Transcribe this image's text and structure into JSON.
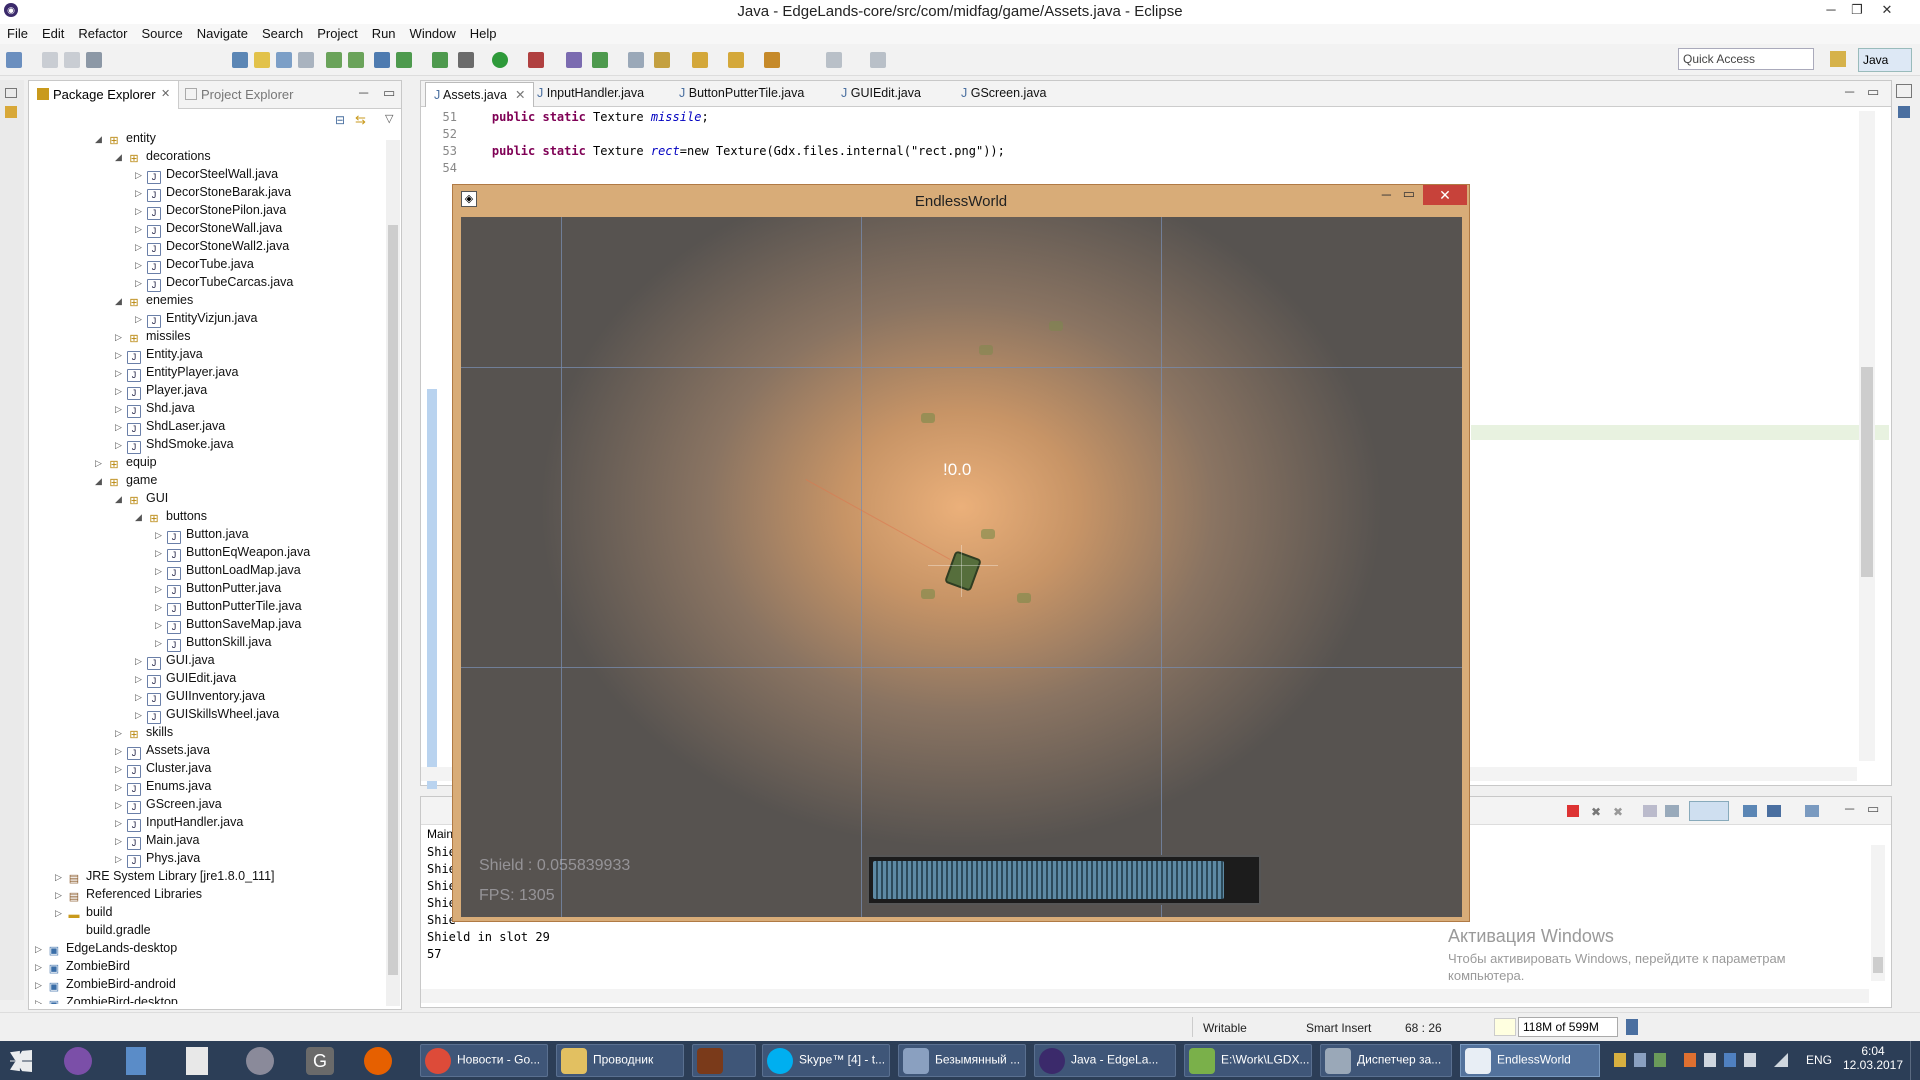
{
  "window": {
    "title": "Java - EdgeLands-core/src/com/midfag/game/Assets.java - Eclipse",
    "minimize": "─",
    "maximize": "❐",
    "close": "✕"
  },
  "menu": [
    "File",
    "Edit",
    "Refactor",
    "Source",
    "Navigate",
    "Search",
    "Project",
    "Run",
    "Window",
    "Help"
  ],
  "toolbar": {
    "quick_access": "Quick Access",
    "perspective": "Java"
  },
  "package_explorer": {
    "tab_active": "Package Explorer",
    "tab_other": "Project Explorer",
    "rows": [
      {
        "label": "entity",
        "kind": "pkg",
        "indent": 4,
        "open": true
      },
      {
        "label": "decorations",
        "kind": "pkg",
        "indent": 5,
        "open": true
      },
      {
        "label": "DecorSteelWall.java",
        "kind": "java",
        "indent": 6
      },
      {
        "label": "DecorStoneBarak.java",
        "kind": "java",
        "indent": 6
      },
      {
        "label": "DecorStonePilon.java",
        "kind": "java",
        "indent": 6
      },
      {
        "label": "DecorStoneWall.java",
        "kind": "java",
        "indent": 6
      },
      {
        "label": "DecorStoneWall2.java",
        "kind": "java",
        "indent": 6
      },
      {
        "label": "DecorTube.java",
        "kind": "java",
        "indent": 6
      },
      {
        "label": "DecorTubeCarcas.java",
        "kind": "java",
        "indent": 6
      },
      {
        "label": "enemies",
        "kind": "pkg",
        "indent": 5,
        "open": true
      },
      {
        "label": "EntityVizjun.java",
        "kind": "java",
        "indent": 6
      },
      {
        "label": "missiles",
        "kind": "pkg",
        "indent": 5
      },
      {
        "label": "Entity.java",
        "kind": "java",
        "indent": 5
      },
      {
        "label": "EntityPlayer.java",
        "kind": "java",
        "indent": 5
      },
      {
        "label": "Player.java",
        "kind": "java",
        "indent": 5
      },
      {
        "label": "Shd.java",
        "kind": "java",
        "indent": 5
      },
      {
        "label": "ShdLaser.java",
        "kind": "java",
        "indent": 5
      },
      {
        "label": "ShdSmoke.java",
        "kind": "java",
        "indent": 5
      },
      {
        "label": "equip",
        "kind": "pkg",
        "indent": 4
      },
      {
        "label": "game",
        "kind": "pkg",
        "indent": 4,
        "open": true
      },
      {
        "label": "GUI",
        "kind": "pkg",
        "indent": 5,
        "open": true
      },
      {
        "label": "buttons",
        "kind": "pkg",
        "indent": 6,
        "open": true
      },
      {
        "label": "Button.java",
        "kind": "java",
        "indent": 7
      },
      {
        "label": "ButtonEqWeapon.java",
        "kind": "java",
        "indent": 7
      },
      {
        "label": "ButtonLoadMap.java",
        "kind": "java",
        "indent": 7
      },
      {
        "label": "ButtonPutter.java",
        "kind": "java",
        "indent": 7
      },
      {
        "label": "ButtonPutterTile.java",
        "kind": "java",
        "indent": 7
      },
      {
        "label": "ButtonSaveMap.java",
        "kind": "java",
        "indent": 7
      },
      {
        "label": "ButtonSkill.java",
        "kind": "java",
        "indent": 7
      },
      {
        "label": "GUI.java",
        "kind": "java",
        "indent": 6
      },
      {
        "label": "GUIEdit.java",
        "kind": "java",
        "indent": 6
      },
      {
        "label": "GUIInventory.java",
        "kind": "java",
        "indent": 6
      },
      {
        "label": "GUISkillsWheel.java",
        "kind": "java",
        "indent": 6
      },
      {
        "label": "skills",
        "kind": "pkg",
        "indent": 5
      },
      {
        "label": "Assets.java",
        "kind": "java",
        "indent": 5
      },
      {
        "label": "Cluster.java",
        "kind": "java",
        "indent": 5
      },
      {
        "label": "Enums.java",
        "kind": "java",
        "indent": 5
      },
      {
        "label": "GScreen.java",
        "kind": "java",
        "indent": 5
      },
      {
        "label": "InputHandler.java",
        "kind": "java",
        "indent": 5
      },
      {
        "label": "Main.java",
        "kind": "java",
        "indent": 5
      },
      {
        "label": "Phys.java",
        "kind": "java",
        "indent": 5
      },
      {
        "label": "JRE System Library [jre1.8.0_111]",
        "kind": "lib",
        "indent": 2
      },
      {
        "label": "Referenced Libraries",
        "kind": "lib",
        "indent": 2
      },
      {
        "label": "build",
        "kind": "fold",
        "indent": 2
      },
      {
        "label": "build.gradle",
        "kind": "file",
        "indent": 2
      },
      {
        "label": "EdgeLands-desktop",
        "kind": "proj",
        "indent": 1
      },
      {
        "label": "ZombieBird",
        "kind": "proj",
        "indent": 1
      },
      {
        "label": "ZombieBird-android",
        "kind": "proj",
        "indent": 1
      },
      {
        "label": "ZombieBird-desktop",
        "kind": "proj",
        "indent": 1
      }
    ]
  },
  "editor": {
    "tabs": [
      "Assets.java",
      "InputHandler.java",
      "ButtonPutterTile.java",
      "GUIEdit.java",
      "GScreen.java"
    ],
    "code": [
      {
        "n": "51",
        "kw": "public static",
        "type": " Texture ",
        "field": "missile",
        "rest": ";"
      },
      {
        "n": "52",
        "kw": "",
        "type": "",
        "field": "",
        "rest": ""
      },
      {
        "n": "53",
        "kw": "public static",
        "type": " Texture ",
        "field": "rect",
        "rest": "=new Texture(Gdx.files.internal(\"rect.png\"));"
      },
      {
        "n": "54",
        "kw": "",
        "type": "",
        "field": "",
        "rest": ""
      }
    ]
  },
  "console": {
    "tab_main": "Main",
    "lines": [
      "Shie",
      "Shie",
      "Shie",
      "Shie",
      "Shie",
      "Shield in slot 29",
      "57"
    ],
    "watermark_title": "Активация Windows",
    "watermark_text1": "Чтобы активировать Windows, перейдите к параметрам",
    "watermark_text2": "компьютера."
  },
  "status": {
    "writable": "Writable",
    "insert": "Smart Insert",
    "pos": "68 : 26",
    "heap": "118M of 599M"
  },
  "game": {
    "title": "EndlessWorld",
    "center_text": "!0.0",
    "shield": "Shield : 0.055839933",
    "fps": "FPS: 1305",
    "bar_fill": 0.92
  },
  "taskbar": {
    "items": [
      "Новости - Go...",
      "Проводник",
      "",
      "Skype™ [4] - t...",
      "Безымянный ...",
      "Java - EdgeLa...",
      "E:\\Work\\LGDX...",
      "Диспетчер за...",
      "EndlessWorld"
    ],
    "lang": "ENG",
    "time": "6:04",
    "date": "12.03.2017"
  },
  "colors": {
    "accent": "#3a6ea8",
    "keyword": "#7f0055",
    "field": "#0000c0",
    "string": "#2a00ff",
    "taskbar": "#2c3e57"
  }
}
